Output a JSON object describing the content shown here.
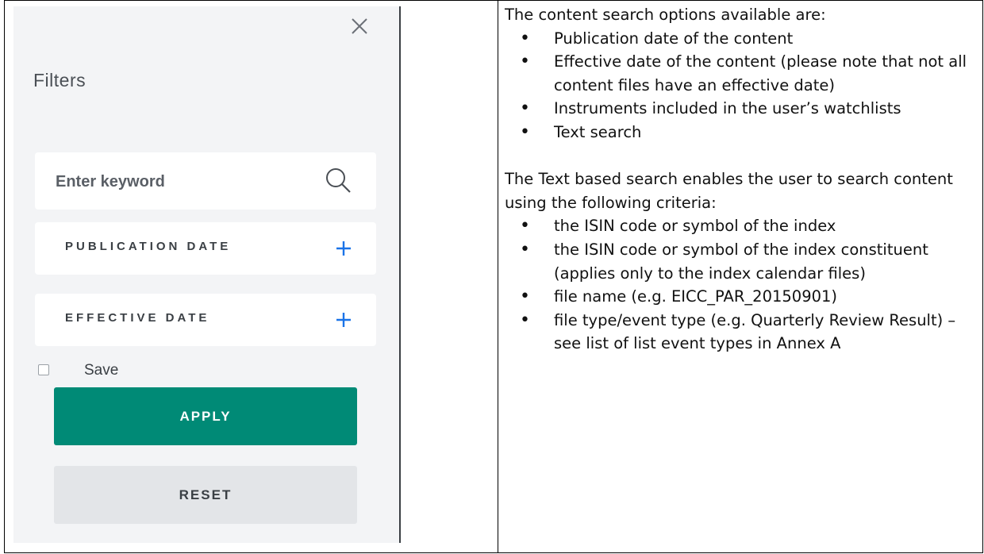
{
  "filters_panel": {
    "title": "Filters",
    "close_icon": "close-icon",
    "search": {
      "placeholder": "Enter keyword",
      "value": "",
      "icon": "search-icon"
    },
    "publication_date": {
      "label": "PUBLICATION DATE",
      "icon": "plus-icon"
    },
    "effective_date": {
      "label": "EFFECTIVE DATE",
      "icon": "plus-icon"
    },
    "save": {
      "label": "Save",
      "checked": false
    },
    "apply_label": "APPLY",
    "reset_label": "RESET",
    "colors": {
      "apply": "#008a76",
      "plus": "#1a73e8",
      "panel_bg": "#f3f4f6"
    }
  },
  "description": {
    "intro": "The content search options available are:",
    "options": [
      "Publication date of the content",
      "Effective date of the content (please note that not all content files have an effective date)",
      "Instruments included in the user’s watchlists",
      "Text search"
    ],
    "text_search_intro": "The Text based search enables the user to search content using the following criteria:",
    "criteria": [
      "the ISIN code or symbol of the index",
      "the ISIN code or symbol of the index constituent (applies only to the index calendar files)",
      "file name (e.g. EICC_PAR_20150901)",
      "file type/event type (e.g. Quarterly Review Result) – see list of list event types in Annex A"
    ]
  }
}
